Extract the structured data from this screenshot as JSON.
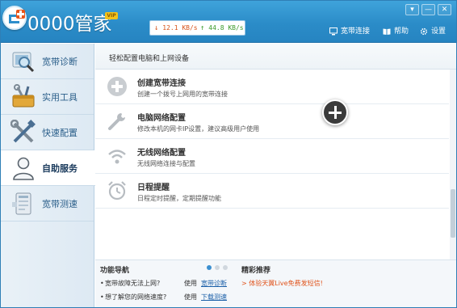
{
  "app": {
    "title": "0000管家",
    "speed_down": "12.1 KB/s",
    "speed_up": "44.8 KB/s",
    "arrow_down": "↓",
    "arrow_up": "↑"
  },
  "window_controls": {
    "menu": "▾",
    "minimize": "—",
    "close": "✕"
  },
  "top_links": [
    {
      "label": "宽带连接",
      "icon": "monitor-icon"
    },
    {
      "label": "帮助",
      "icon": "book-icon"
    },
    {
      "label": "设置",
      "icon": "gear-icon"
    }
  ],
  "sidebar": {
    "items": [
      {
        "label": "宽带诊断",
        "icon": "magnifier-icon",
        "active": false
      },
      {
        "label": "实用工具",
        "icon": "toolbox-icon",
        "active": false
      },
      {
        "label": "快速配置",
        "icon": "tools-icon",
        "active": false
      },
      {
        "label": "自助服务",
        "icon": "user-icon",
        "active": true
      },
      {
        "label": "宽带测速",
        "icon": "speed-test-icon",
        "active": false
      }
    ]
  },
  "main": {
    "header": "轻松配置电脑和上网设备",
    "services": [
      {
        "title": "创建宽带连接",
        "desc": "创建一个拨号上网用的宽带连接",
        "icon": "plus-circle-icon"
      },
      {
        "title": "电脑网络配置",
        "desc": "修改本机的网卡IP设置，建议高级用户使用",
        "icon": "wrench-icon"
      },
      {
        "title": "无线网络配置",
        "desc": "无线网络连接与配置",
        "icon": "wifi-icon"
      },
      {
        "title": "日程提醒",
        "desc": "日程定时提醒，定期提醒功能",
        "icon": "alarm-clock-icon"
      }
    ]
  },
  "footer": {
    "nav_title": "功能导航",
    "rec_title": "精彩推荐",
    "use_label": "使用",
    "bullet": "•",
    "promo": "> 体验天翼Live免费发短信!",
    "rows": [
      {
        "question": "宽带故障无法上网?",
        "link": "宽带诊断"
      },
      {
        "question": "想了解您的网络速度?",
        "link": "下载测速"
      }
    ]
  },
  "colors": {
    "header_blue": "#2b8cc8",
    "accent_orange": "#e8561b",
    "link_blue": "#1a5fa8",
    "sidebar_bg": "#e3edf5"
  }
}
